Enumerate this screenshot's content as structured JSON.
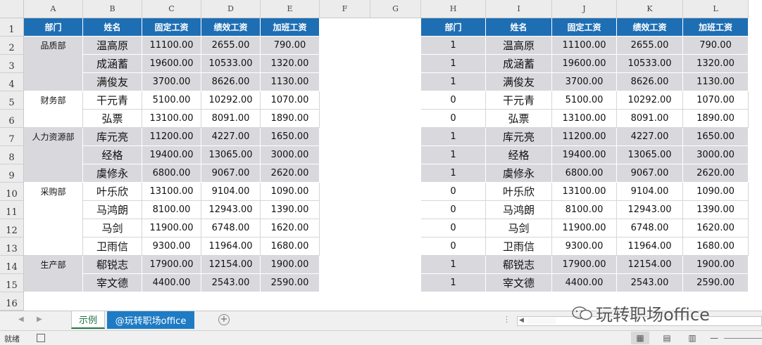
{
  "columns": [
    "A",
    "B",
    "C",
    "D",
    "E",
    "F",
    "G",
    "H",
    "I",
    "J",
    "K",
    "L"
  ],
  "rows": [
    "1",
    "2",
    "3",
    "4",
    "5",
    "6",
    "7",
    "8",
    "9",
    "10",
    "11",
    "12",
    "13",
    "14",
    "15",
    "16"
  ],
  "left_headers": [
    "部门",
    "姓名",
    "固定工资",
    "绩效工资",
    "加班工资"
  ],
  "right_headers": [
    "部门",
    "姓名",
    "固定工资",
    "绩效工资",
    "加班工资"
  ],
  "departments": [
    {
      "name": "品质部",
      "start": 0,
      "span": 3
    },
    {
      "name": "财务部",
      "start": 3,
      "span": 2
    },
    {
      "name": "人力资源部",
      "start": 5,
      "span": 3
    },
    {
      "name": "采购部",
      "start": 8,
      "span": 4
    },
    {
      "name": "生产部",
      "start": 12,
      "span": 2
    }
  ],
  "employees": [
    {
      "flag": "1",
      "name": "温高原",
      "fixed": "11100.00",
      "perf": "2655.00",
      "ot": "790.00"
    },
    {
      "flag": "1",
      "name": "成涵蓄",
      "fixed": "19600.00",
      "perf": "10533.00",
      "ot": "1320.00"
    },
    {
      "flag": "1",
      "name": "满俊友",
      "fixed": "3700.00",
      "perf": "8626.00",
      "ot": "1130.00"
    },
    {
      "flag": "0",
      "name": "干元青",
      "fixed": "5100.00",
      "perf": "10292.00",
      "ot": "1070.00"
    },
    {
      "flag": "0",
      "name": "弘票",
      "fixed": "13100.00",
      "perf": "8091.00",
      "ot": "1890.00"
    },
    {
      "flag": "1",
      "name": "库元亮",
      "fixed": "11200.00",
      "perf": "4227.00",
      "ot": "1650.00"
    },
    {
      "flag": "1",
      "name": "经格",
      "fixed": "19400.00",
      "perf": "13065.00",
      "ot": "3000.00"
    },
    {
      "flag": "1",
      "name": "虞修永",
      "fixed": "6800.00",
      "perf": "9067.00",
      "ot": "2620.00"
    },
    {
      "flag": "0",
      "name": "叶乐欣",
      "fixed": "13100.00",
      "perf": "9104.00",
      "ot": "1090.00"
    },
    {
      "flag": "0",
      "name": "马鸿朗",
      "fixed": "8100.00",
      "perf": "12943.00",
      "ot": "1390.00"
    },
    {
      "flag": "0",
      "name": "马剑",
      "fixed": "11900.00",
      "perf": "6748.00",
      "ot": "1620.00"
    },
    {
      "flag": "0",
      "name": "卫雨信",
      "fixed": "9300.00",
      "perf": "11964.00",
      "ot": "1680.00"
    },
    {
      "flag": "1",
      "name": "郗锐志",
      "fixed": "17900.00",
      "perf": "12154.00",
      "ot": "1900.00"
    },
    {
      "flag": "1",
      "name": "宰文德",
      "fixed": "4400.00",
      "perf": "2543.00",
      "ot": "2590.00"
    }
  ],
  "sheet_tabs": [
    "示例",
    "@玩转职场office"
  ],
  "status": {
    "ready": "就绪"
  },
  "watermark": "玩转职场office",
  "colors": {
    "header_bg": "#1e6eb4",
    "band_gray": "#d9d9dd",
    "active_tab": "#217346",
    "tab2_bg": "#1e7bc4"
  }
}
